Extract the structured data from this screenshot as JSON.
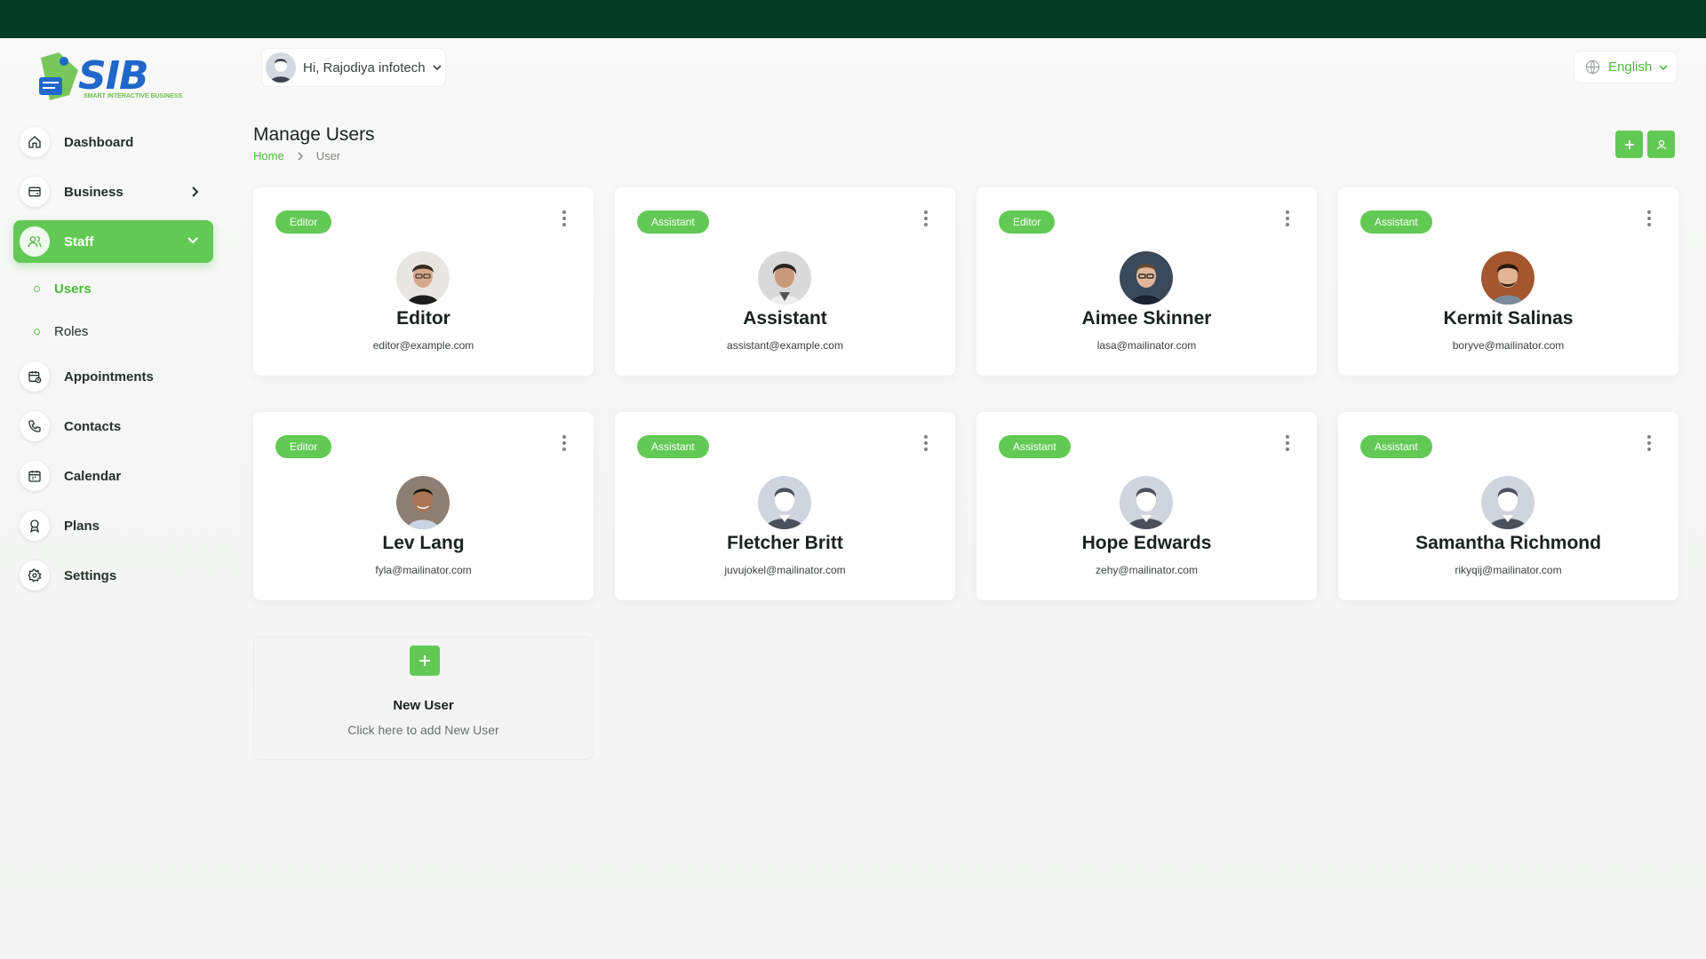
{
  "brand": {
    "name": "SIB",
    "tagline": "SMART INTERACTIVE BUSINESS"
  },
  "header": {
    "greeting": "Hi, Rajodiya infotech",
    "language": "English"
  },
  "sidebar": {
    "items": [
      {
        "label": "Dashboard",
        "icon": "home-icon"
      },
      {
        "label": "Business",
        "icon": "wallet-icon"
      },
      {
        "label": "Staff",
        "icon": "users-icon",
        "active": true
      },
      {
        "label": "Appointments",
        "icon": "calendar-clock-icon"
      },
      {
        "label": "Contacts",
        "icon": "phone-icon"
      },
      {
        "label": "Calendar",
        "icon": "calendar-icon"
      },
      {
        "label": "Plans",
        "icon": "award-icon"
      },
      {
        "label": "Settings",
        "icon": "gear-icon"
      }
    ],
    "staff_sub": [
      {
        "label": "Users",
        "active": true
      },
      {
        "label": "Roles"
      }
    ]
  },
  "page": {
    "title": "Manage Users",
    "breadcrumb": {
      "home": "Home",
      "current": "User"
    }
  },
  "users": [
    {
      "role": "Editor",
      "name": "Editor",
      "email": "editor@example.com"
    },
    {
      "role": "Assistant",
      "name": "Assistant",
      "email": "assistant@example.com"
    },
    {
      "role": "Editor",
      "name": "Aimee Skinner",
      "email": "lasa@mailinator.com"
    },
    {
      "role": "Assistant",
      "name": "Kermit Salinas",
      "email": "boryve@mailinator.com"
    },
    {
      "role": "Editor",
      "name": "Lev Lang",
      "email": "fyla@mailinator.com"
    },
    {
      "role": "Assistant",
      "name": "Fletcher Britt",
      "email": "juvujokel@mailinator.com"
    },
    {
      "role": "Assistant",
      "name": "Hope Edwards",
      "email": "zehy@mailinator.com"
    },
    {
      "role": "Assistant",
      "name": "Samantha Richmond",
      "email": "rikyqij@mailinator.com"
    }
  ],
  "new_user": {
    "title": "New User",
    "subtitle": "Click here to add New User"
  },
  "colors": {
    "accent": "#63c955",
    "topbar": "#053b26",
    "brand_blue": "#1f67c9"
  }
}
